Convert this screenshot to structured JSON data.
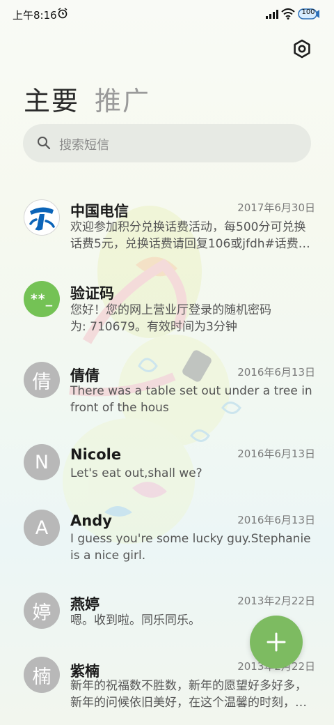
{
  "status_bar": {
    "time": "上午8:16",
    "battery": "100",
    "icons": [
      "alarm-icon",
      "signal-icon",
      "wifi-icon",
      "battery-icon"
    ]
  },
  "header": {
    "settings_icon": "settings-hexagon-icon",
    "tabs": [
      {
        "label": "主要",
        "active": true
      },
      {
        "label": "推广",
        "active": false
      }
    ]
  },
  "search": {
    "placeholder": "搜索短信",
    "icon": "search-icon"
  },
  "messages": [
    {
      "name": "中国电信",
      "date": "2017年6月30日",
      "preview_lines": [
        "欢迎参加积分兑换话费活动，每500分可兑换",
        "话费5元，兑换话费请回复106或jfdh#话费…"
      ],
      "avatar": "china-telecom-logo"
    },
    {
      "name": "验证码",
      "date": "",
      "preview_lines": [
        "您好！您的网上营业厅登录的随机密码",
        "为: 710679。有效时间为3分钟"
      ],
      "avatar_text": "**_"
    },
    {
      "name": "倩倩",
      "date": "2016年6月13日",
      "preview_lines": [
        "There was a table set out under a tree in",
        "front of the hous"
      ],
      "avatar_text": "倩"
    },
    {
      "name": "Nicole",
      "date": "2016年6月13日",
      "preview_lines": [
        "Let's eat out,shall we?"
      ],
      "avatar_text": "N"
    },
    {
      "name": "Andy",
      "date": "2016年6月13日",
      "preview_lines": [
        "I guess you're some lucky guy.Stephanie",
        "is a nice girl."
      ],
      "avatar_text": "A"
    },
    {
      "name": "燕婷",
      "date": "2013年2月22日",
      "preview_lines": [
        "嗯。收到啦。同乐同乐。"
      ],
      "avatar_text": "婷"
    },
    {
      "name": "紫楠",
      "date": "2013年2月22日",
      "preview_lines": [
        "新年的祝福数不胜数，新年的愿望好多好多，",
        "新年的问候依旧美好，在这个温馨的时刻，…"
      ],
      "avatar_text": "楠"
    }
  ],
  "fab": {
    "icon": "plus-icon"
  },
  "colors": {
    "accent": "#7dbb61",
    "verification_avatar": "#74c255",
    "contact_avatar": "#b8b8b8",
    "telecom_blue": "#0b64b8"
  }
}
